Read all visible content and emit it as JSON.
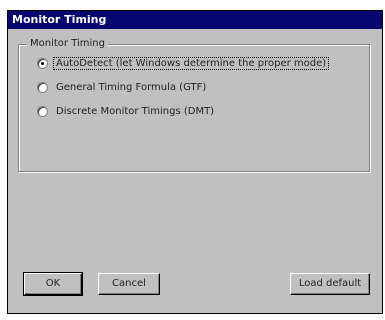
{
  "window": {
    "title": "Monitor Timing"
  },
  "group": {
    "label": "Monitor Timing"
  },
  "options": [
    {
      "label": "AutoDetect (let Windows determine the proper mode)",
      "selected": true
    },
    {
      "label": "General Timing Formula (GTF)",
      "selected": false
    },
    {
      "label": "Discrete Monitor Timings (DMT)",
      "selected": false
    }
  ],
  "buttons": {
    "ok": "OK",
    "cancel": "Cancel",
    "load_default": "Load default"
  },
  "colors": {
    "titlebar": "#06066e",
    "face": "#c0c0c0"
  }
}
